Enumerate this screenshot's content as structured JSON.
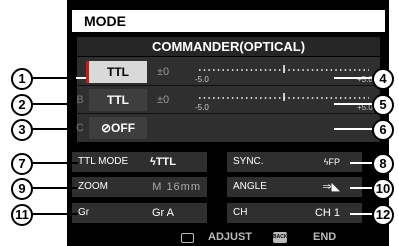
{
  "header": {
    "title": "MODE"
  },
  "commander": {
    "title": "COMMANDER(OPTICAL)"
  },
  "groups": [
    {
      "letter": "",
      "mode": "TTL",
      "comp": "±0",
      "scale_min": "-5.0",
      "scale_max": "+5.0"
    },
    {
      "letter": "B",
      "mode": "TTL",
      "comp": "±0",
      "scale_min": "-5.0",
      "scale_max": "+5.0"
    },
    {
      "letter": "C",
      "mode": "⊘OFF",
      "comp": "",
      "scale_min": "",
      "scale_max": ""
    }
  ],
  "settings": {
    "ttl_mode": {
      "label": "TTL MODE",
      "value": "ϟTTL"
    },
    "sync": {
      "label": "SYNC.",
      "value": "ϟFP"
    },
    "zoom": {
      "label": "ZOOM",
      "value": "M 16mm"
    },
    "angle": {
      "label": "ANGLE",
      "value": "⇒◣"
    },
    "gr": {
      "label": "Gr",
      "value": "Gr A"
    },
    "ch": {
      "label": "CH",
      "value": "CH 1"
    }
  },
  "footer": {
    "adjust_icon": "monitor-icon",
    "adjust_label": "ADJUST",
    "end_icon": "back-icon",
    "back_glyph": "BACK",
    "end_label": "END"
  },
  "callouts": [
    "1",
    "2",
    "3",
    "4",
    "5",
    "6",
    "7",
    "8",
    "9",
    "10",
    "11",
    "12"
  ]
}
